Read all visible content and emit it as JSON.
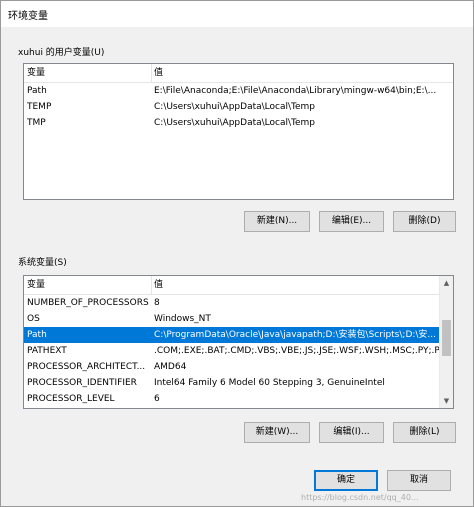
{
  "window": {
    "title": "环境变量"
  },
  "user_vars": {
    "group_label": "xuhui 的用户变量(U)",
    "col_name": "变量",
    "col_value": "值",
    "rows": [
      {
        "name": "Path",
        "value": "E:\\File\\Anaconda;E:\\File\\Anaconda\\Library\\mingw-w64\\bin;E:\\...",
        "selected": false
      },
      {
        "name": "TEMP",
        "value": "C:\\Users\\xuhui\\AppData\\Local\\Temp",
        "selected": false
      },
      {
        "name": "TMP",
        "value": "C:\\Users\\xuhui\\AppData\\Local\\Temp",
        "selected": false
      }
    ],
    "new_label": "新建(N)...",
    "edit_label": "编辑(E)...",
    "delete_label": "删除(D)"
  },
  "sys_vars": {
    "group_label": "系统变量(S)",
    "col_name": "变量",
    "col_value": "值",
    "rows": [
      {
        "name": "NUMBER_OF_PROCESSORS",
        "value": "8",
        "selected": false
      },
      {
        "name": "OS",
        "value": "Windows_NT",
        "selected": false
      },
      {
        "name": "Path",
        "value": "C:\\ProgramData\\Oracle\\Java\\javapath;D:\\安装包\\Scripts\\;D:\\安...",
        "selected": true
      },
      {
        "name": "PATHEXT",
        "value": ".COM;.EXE;.BAT;.CMD;.VBS;.VBE;.JS;.JSE;.WSF;.WSH;.MSC;.PY;.P...",
        "selected": false
      },
      {
        "name": "PROCESSOR_ARCHITECT...",
        "value": "AMD64",
        "selected": false
      },
      {
        "name": "PROCESSOR_IDENTIFIER",
        "value": "Intel64 Family 6 Model 60 Stepping 3, GenuineIntel",
        "selected": false
      },
      {
        "name": "PROCESSOR_LEVEL",
        "value": "6",
        "selected": false
      }
    ],
    "new_label": "新建(W)...",
    "edit_label": "编辑(I)...",
    "delete_label": "删除(L)"
  },
  "footer": {
    "ok_label": "确定",
    "cancel_label": "取消"
  },
  "watermark": "https://blog.csdn.net/qq_40..."
}
